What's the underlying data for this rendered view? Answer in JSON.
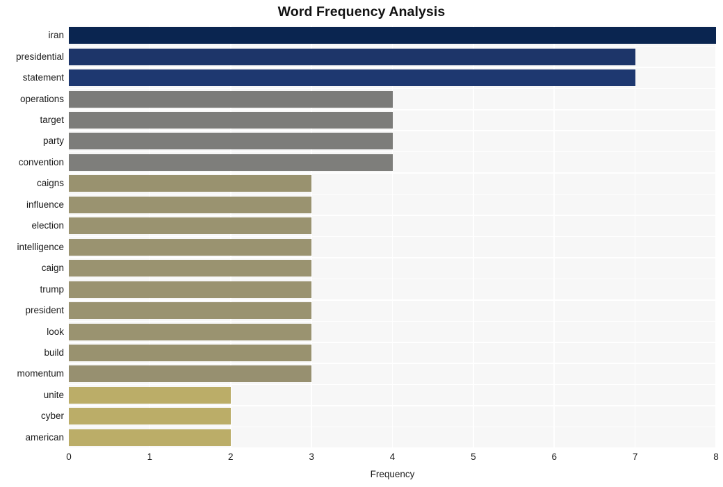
{
  "chart_data": {
    "type": "bar",
    "orientation": "horizontal",
    "title": "Word Frequency Analysis",
    "xlabel": "Frequency",
    "ylabel": "",
    "xlim": [
      0,
      8
    ],
    "xticks": [
      0,
      1,
      2,
      3,
      4,
      5,
      6,
      7,
      8
    ],
    "grid": true,
    "legend": false,
    "categories": [
      "iran",
      "presidential",
      "statement",
      "operations",
      "target",
      "party",
      "convention",
      "caigns",
      "influence",
      "election",
      "intelligence",
      "caign",
      "trump",
      "president",
      "look",
      "build",
      "momentum",
      "unite",
      "cyber",
      "american"
    ],
    "values": [
      8,
      7,
      7,
      4,
      4,
      4,
      4,
      3,
      3,
      3,
      3,
      3,
      3,
      3,
      3,
      3,
      3,
      2,
      2,
      2
    ],
    "bar_colors": [
      "#0a2550",
      "#1d3569",
      "#1e3870",
      "#7b7b79",
      "#7c7c7a",
      "#7d7d7a",
      "#7e7e7b",
      "#99926f",
      "#9a9370",
      "#9a9370",
      "#9a9370",
      "#9a9370",
      "#9a9370",
      "#9a9370",
      "#9a9370",
      "#99926f",
      "#979070",
      "#bbad68",
      "#bbad68",
      "#bbad68"
    ]
  },
  "style": {
    "plot_background": "#f7f7f7",
    "figure_background": "#ffffff",
    "grid_color": "#ffffff",
    "text_color": "#1a1a1a"
  }
}
